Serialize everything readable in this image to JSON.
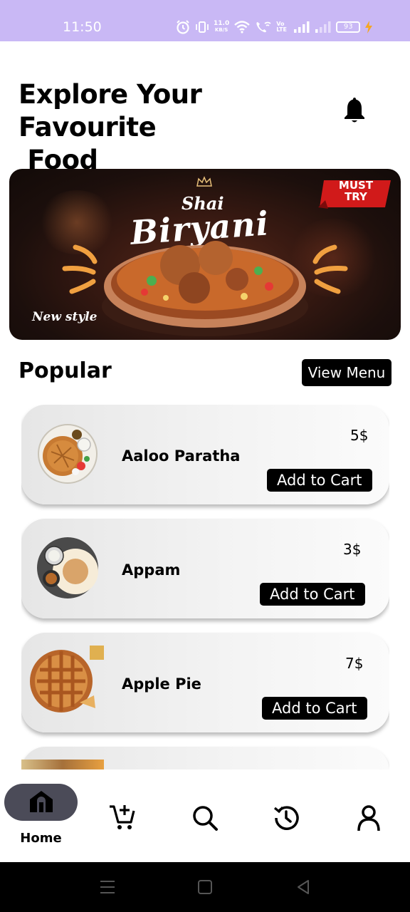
{
  "status_bar": {
    "time": "11:50",
    "net_speed_value": "11.0",
    "net_speed_unit": "KB/S",
    "volte_label": "Vo LTE",
    "battery": "93",
    "background_color": "#c9b8f5"
  },
  "header": {
    "title": "Explore Your Favourite\n Food",
    "notification_icon": "bell-icon"
  },
  "banner": {
    "subtitle": "Shai",
    "title": "Biryani",
    "badge": "MUST TRY",
    "tag": "New style"
  },
  "popular": {
    "title": "Popular",
    "view_menu_label": "View Menu",
    "items": [
      {
        "name": "Aaloo Paratha",
        "price": "5$",
        "button": "Add to Cart"
      },
      {
        "name": "Appam",
        "price": "3$",
        "button": "Add to Cart"
      },
      {
        "name": "Apple Pie",
        "price": "7$",
        "button": "Add to Cart"
      }
    ]
  },
  "bottom_nav": {
    "items": [
      {
        "label": "Home",
        "icon": "home-icon",
        "active": true
      },
      {
        "label": "",
        "icon": "cart-add-icon"
      },
      {
        "label": "",
        "icon": "search-icon"
      },
      {
        "label": "",
        "icon": "history-icon"
      },
      {
        "label": "",
        "icon": "profile-icon"
      }
    ]
  },
  "system_nav": {
    "items": [
      "menu-icon",
      "home-square-icon",
      "back-icon"
    ]
  }
}
